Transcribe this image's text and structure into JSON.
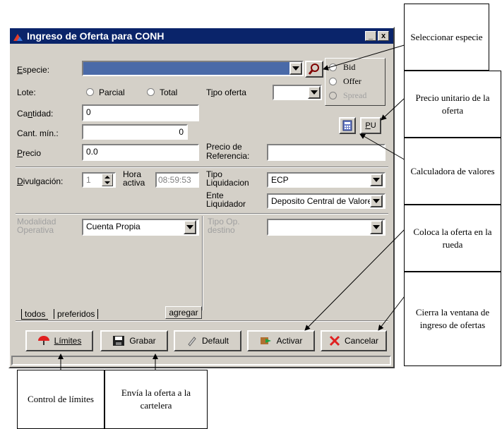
{
  "window": {
    "title": "Ingreso de Oferta para CONH",
    "minimize": "_",
    "close": "x"
  },
  "form": {
    "especie_label": "Especie:",
    "lote_label": "Lote:",
    "parcial": "Parcial",
    "total": "Total",
    "tipo_oferta_label": "Tipo oferta",
    "cantidad_label": "Cantidad:",
    "cantidad_value": "0",
    "cant_min_label": "Cant. mín.:",
    "cant_min_value": "0",
    "precio_label": "Precio",
    "precio_value": "0.0",
    "precio_ref_label_1": "Precio de",
    "precio_ref_label_2": "Referencia:",
    "bid": "Bid",
    "offer": "Offer",
    "spread": "Spread",
    "pu_label": "PU",
    "divulgacion_label": "Divulgación:",
    "divulgacion_value": "1",
    "hora_label_1": "Hora",
    "hora_label_2": "activa",
    "hora_value": "08:59:53",
    "tipo_liq_label_1": "Tipo",
    "tipo_liq_label_2": "Liquidacion",
    "tipo_liq_value": "ECP",
    "ente_label_1": "Ente",
    "ente_label_2": "Liquidador",
    "ente_value": "Deposito Central de Valores",
    "modalidad_label_1": "Modalidad",
    "modalidad_label_2": "Operativa",
    "modalidad_value": "Cuenta Propia",
    "tipo_op_label_1": "Tipo Op.",
    "tipo_op_label_2": "destino"
  },
  "tabs": {
    "todos": "todos",
    "preferidos": "preferidos",
    "agregar": "agregar"
  },
  "buttons": {
    "limites": "Límites",
    "grabar": "Grabar",
    "default": "Default",
    "activar": "Activar",
    "cancelar": "Cancelar"
  },
  "callouts": {
    "seleccionar": "Seleccionar especie",
    "precio_unitario": "Precio unitario de la oferta",
    "calculadora": "Calculadora de valores",
    "coloca": "Coloca la oferta en la rueda",
    "cierra": "Cierra la ventana de ingreso de ofertas",
    "control": "Control de límites",
    "envia": "Envía la oferta a la cartelera"
  },
  "colors": {
    "titlebar": "#0a246a",
    "window_face": "#d4d0c8",
    "especie_fill": "#4a6aa8"
  }
}
